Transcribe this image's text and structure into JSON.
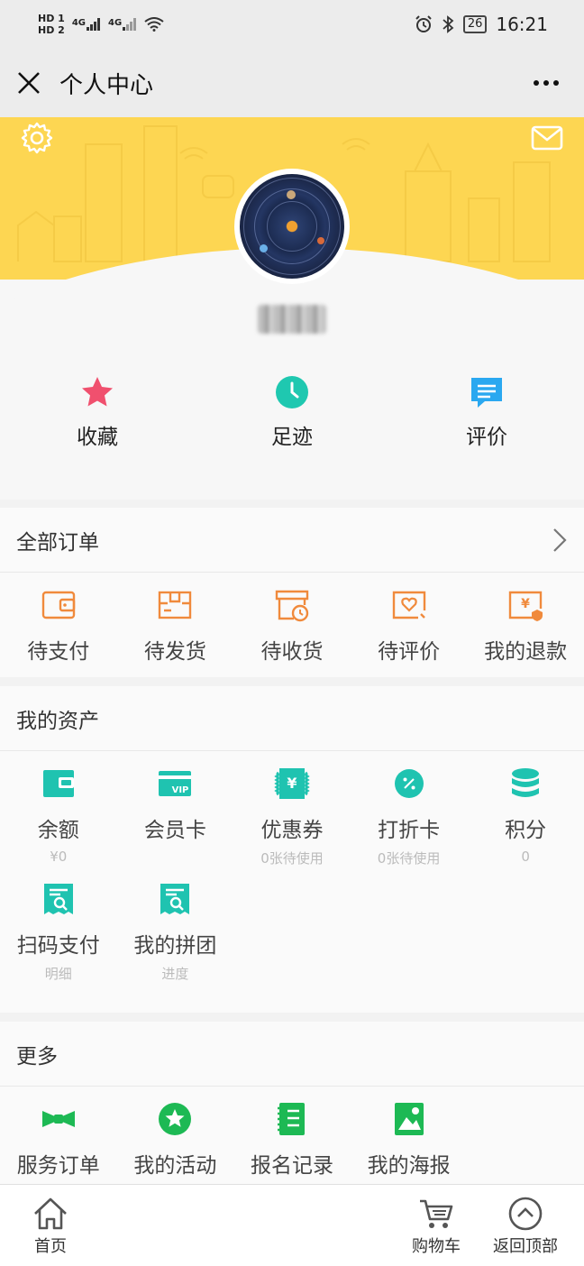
{
  "status_bar": {
    "sim1": "HD 1",
    "sim2": "HD 2",
    "net1": "4G",
    "net2": "4G",
    "battery": "26",
    "time": "16:21"
  },
  "titlebar": {
    "title": "个人中心"
  },
  "quick_actions": [
    {
      "label": "收藏",
      "icon": "star-icon",
      "color": "#f0506e"
    },
    {
      "label": "足迹",
      "icon": "clock-icon",
      "color": "#1fc8b0"
    },
    {
      "label": "评价",
      "icon": "comment-icon",
      "color": "#2aa8f0"
    }
  ],
  "orders": {
    "title": "全部订单",
    "items": [
      {
        "label": "待支付",
        "icon": "wallet-icon"
      },
      {
        "label": "待发货",
        "icon": "package-icon"
      },
      {
        "label": "待收货",
        "icon": "delivery-clock-icon"
      },
      {
        "label": "待评价",
        "icon": "review-icon"
      },
      {
        "label": "我的退款",
        "icon": "refund-icon"
      }
    ],
    "accent": "#f08a3c"
  },
  "assets": {
    "title": "我的资产",
    "items": [
      {
        "label": "余额",
        "sub": "¥0",
        "icon": "wallet-icon"
      },
      {
        "label": "会员卡",
        "sub": "",
        "icon": "vip-card-icon"
      },
      {
        "label": "优惠券",
        "sub": "0张待使用",
        "icon": "coupon-icon"
      },
      {
        "label": "打折卡",
        "sub": "0张待使用",
        "icon": "discount-icon"
      },
      {
        "label": "积分",
        "sub": "0",
        "icon": "coins-icon"
      },
      {
        "label": "扫码支付",
        "sub": "明细",
        "icon": "scan-receipt-icon"
      },
      {
        "label": "我的拼团",
        "sub": "进度",
        "icon": "group-receipt-icon"
      }
    ],
    "accent": "#1fc3b0"
  },
  "more": {
    "title": "更多",
    "items": [
      {
        "label": "服务订单",
        "icon": "bowtie-icon"
      },
      {
        "label": "我的活动",
        "icon": "star-badge-icon"
      },
      {
        "label": "报名记录",
        "icon": "notebook-icon"
      },
      {
        "label": "我的海报",
        "icon": "poster-icon"
      }
    ],
    "accent": "#1db954"
  },
  "tabbar": {
    "home": "首页",
    "cart": "购物车",
    "top": "返回顶部"
  }
}
